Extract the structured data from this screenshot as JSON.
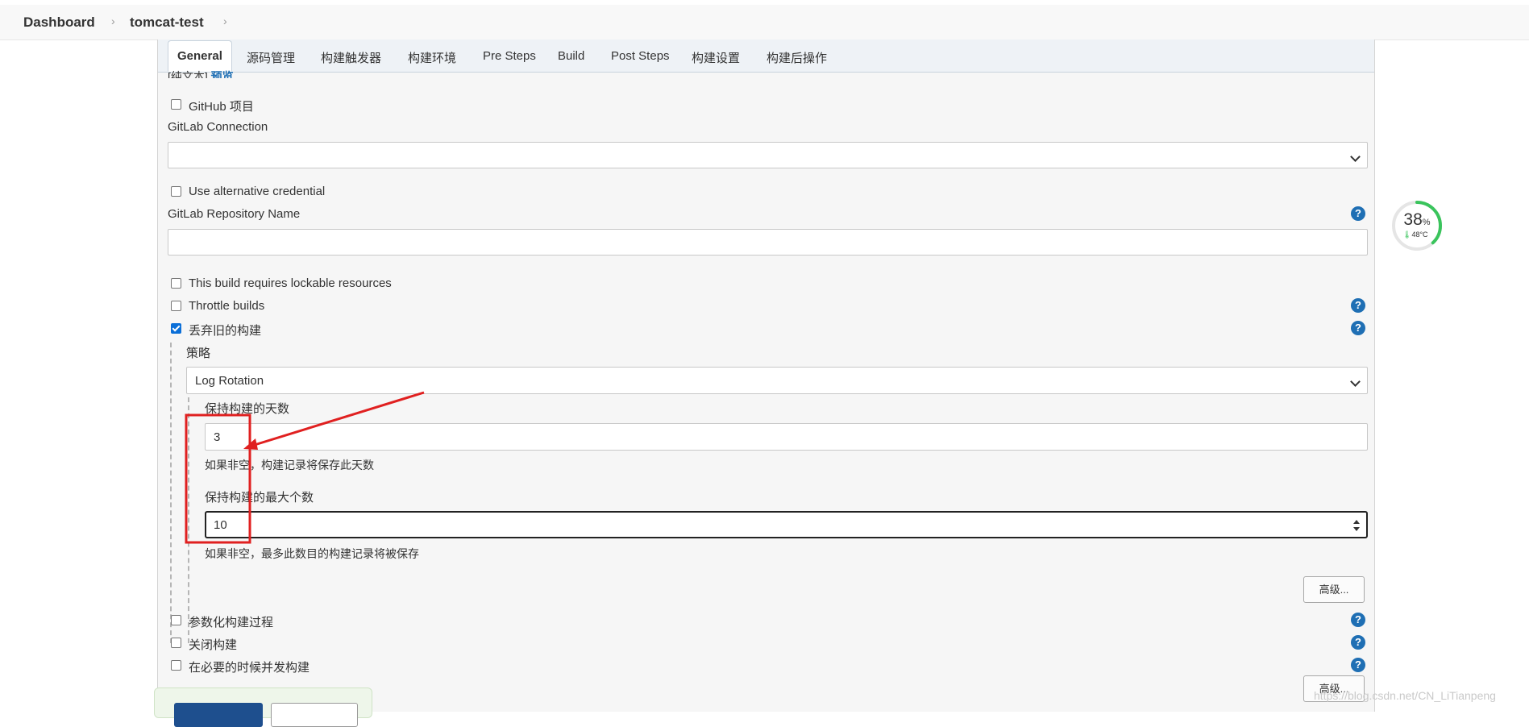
{
  "breadcrumb": {
    "dashboard": "Dashboard",
    "project": "tomcat-test"
  },
  "tabs": [
    "General",
    "源码管理",
    "构建触发器",
    "构建环境",
    "Pre Steps",
    "Build",
    "Post Steps",
    "构建设置",
    "构建后操作"
  ],
  "cut_text": {
    "plain": "[纯文本]",
    "preview": "预览"
  },
  "github_project": {
    "label": "GitHub 项目",
    "checked": false
  },
  "gitlab_connection": {
    "label": "GitLab Connection",
    "value": ""
  },
  "alt_credential": {
    "label": "Use alternative credential",
    "checked": false
  },
  "gitlab_repo": {
    "label": "GitLab Repository Name",
    "value": ""
  },
  "lockable": {
    "label": "This build requires lockable resources",
    "checked": false
  },
  "throttle": {
    "label": "Throttle builds",
    "checked": false
  },
  "discard_old": {
    "label": "丢弃旧的构建",
    "checked": true
  },
  "strategy": {
    "label": "策略",
    "value": "Log Rotation"
  },
  "days_to_keep": {
    "label": "保持构建的天数",
    "value": "3",
    "hint": "如果非空，构建记录将保存此天数"
  },
  "max_builds": {
    "label": "保持构建的最大个数",
    "value": "10",
    "hint": "如果非空，最多此数目的构建记录将被保存"
  },
  "advanced_label": "高级...",
  "parameterized": {
    "label": "参数化构建过程",
    "checked": false
  },
  "disable_build": {
    "label": "关闭构建",
    "checked": false
  },
  "concurrent": {
    "label": "在必要的时候并发构建",
    "checked": false
  },
  "help_label": "?",
  "gauge": {
    "percent": "38",
    "unit": "%",
    "temp": "48°C"
  },
  "watermark": "https://blog.csdn.net/CN_LiTianpeng",
  "colors": {
    "accent": "#0b6fd8",
    "help": "#1f6fb4",
    "annotation": "#e02020",
    "gauge": "#3ac45c"
  }
}
